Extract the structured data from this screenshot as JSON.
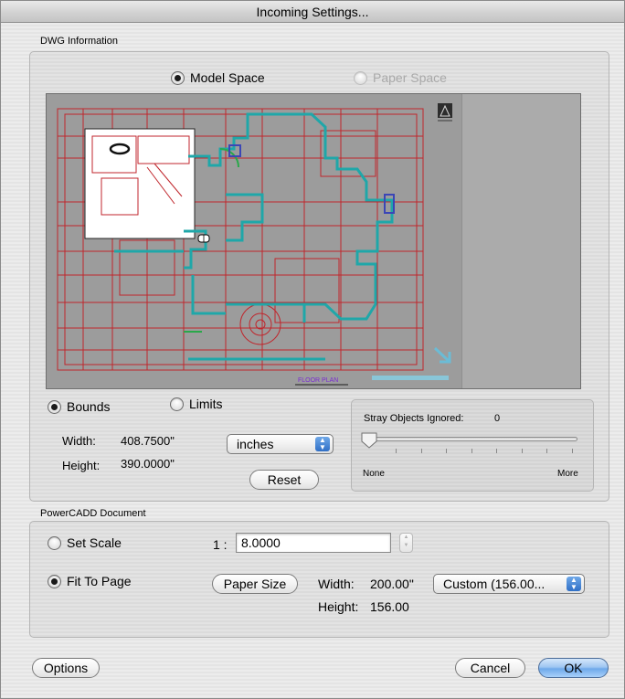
{
  "window": {
    "title": "Incoming Settings..."
  },
  "dwg": {
    "label": "DWG Information",
    "space": {
      "model": "Model Space",
      "paper": "Paper Space",
      "selected": "model"
    },
    "preview": {
      "drawing_label": "FLOOR PLAN",
      "logo_icon": "autodesk-logo-icon",
      "arrow_icon": "arrow-down-right-icon"
    },
    "extent": {
      "bounds": "Bounds",
      "limits": "Limits",
      "selected": "bounds"
    },
    "width_label": "Width:",
    "width_value": "408.7500\"",
    "height_label": "Height:",
    "height_value": "390.0000\"",
    "units": "inches",
    "reset_label": "Reset",
    "stray": {
      "label": "Stray Objects Ignored:",
      "count": "0",
      "min_label": "None",
      "max_label": "More",
      "level": 0
    }
  },
  "powercadd": {
    "label": "PowerCADD Document",
    "set_scale_label": "Set Scale",
    "scale_prefix": "1 :",
    "scale_value": "8.0000",
    "fit_to_page_label": "Fit To Page",
    "selected": "fit",
    "paper_size_label": "Paper Size",
    "width_label": "Width:",
    "width_value": "200.00\"",
    "height_label": "Height:",
    "height_value": "156.00",
    "paper_popup": "Custom (156.00..."
  },
  "buttons": {
    "options": "Options",
    "cancel": "Cancel",
    "ok": "OK"
  },
  "colors": {
    "drawing_red": "#c0262c",
    "drawing_teal": "#1fa7a9",
    "preview_bg": "#9c9c9c",
    "accent_blue": "#6fa9ea"
  }
}
